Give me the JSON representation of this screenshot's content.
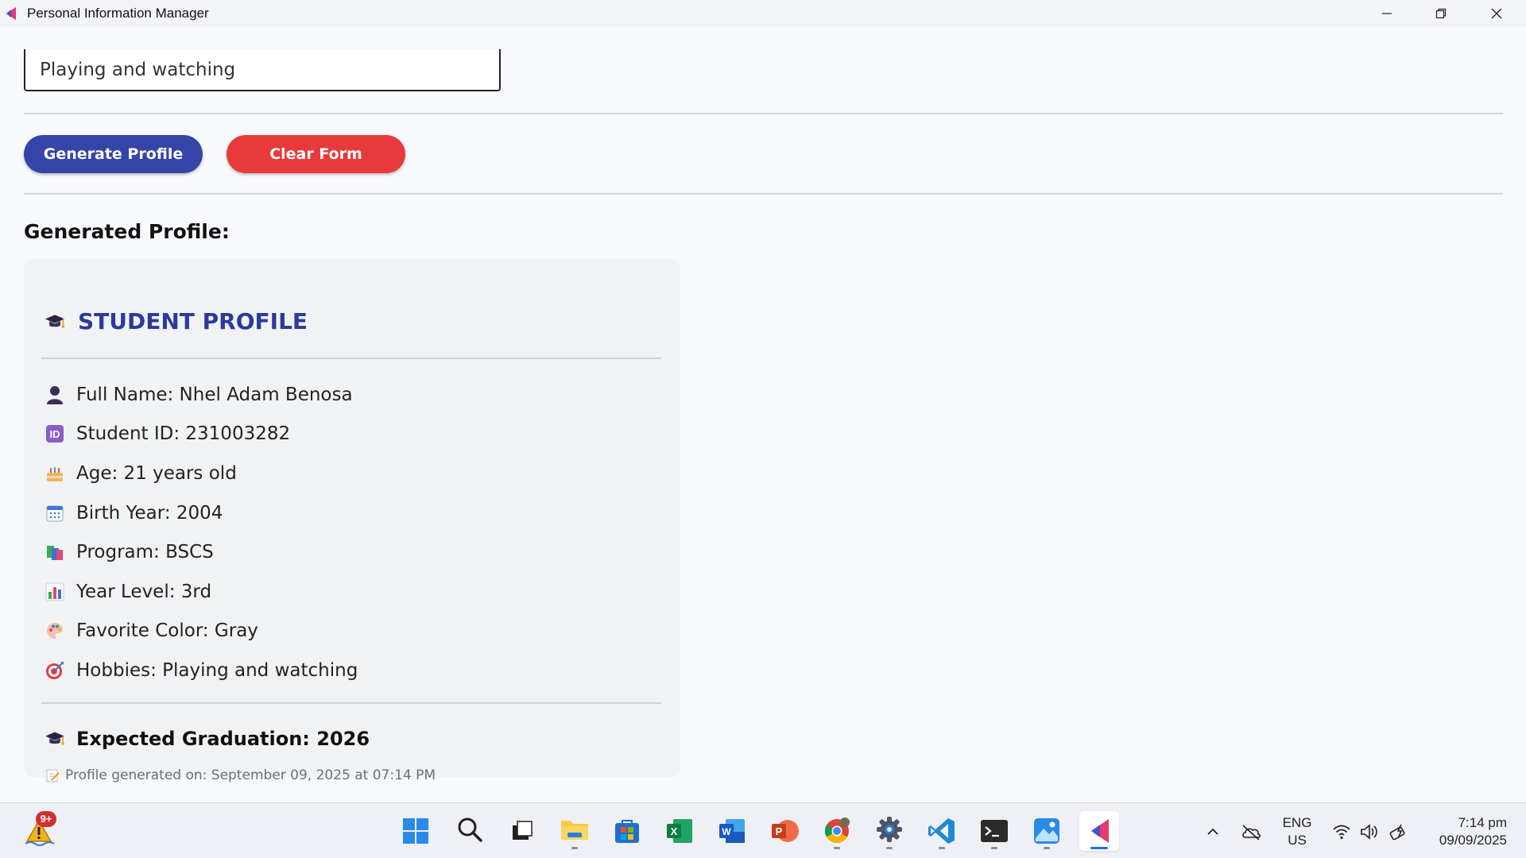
{
  "window": {
    "title": "Personal Information Manager"
  },
  "form": {
    "hobbies_value": "Playing and watching",
    "generate_label": "Generate Profile",
    "clear_label": "Clear Form"
  },
  "output": {
    "section_title": "Generated Profile:",
    "card": {
      "title": "STUDENT PROFILE",
      "title_icon": "graduation-cap-icon",
      "items": [
        {
          "icon": "person-icon",
          "text": "Full Name: Nhel Adam Benosa"
        },
        {
          "icon": "id-icon",
          "text": "Student ID: 231003282"
        },
        {
          "icon": "cake-icon",
          "text": "Age: 21 years old"
        },
        {
          "icon": "calendar-icon",
          "text": "Birth Year: 2004"
        },
        {
          "icon": "books-icon",
          "text": "Program: BSCS"
        },
        {
          "icon": "bar-chart-icon",
          "text": "Year Level: 3rd"
        },
        {
          "icon": "palette-icon",
          "text": "Favorite Color: Gray"
        },
        {
          "icon": "target-icon",
          "text": "Hobbies: Playing and watching"
        }
      ],
      "graduation": "Expected Graduation: 2026",
      "timestamp": "Profile generated on: September 09, 2025 at 07:14 PM"
    }
  },
  "taskbar": {
    "weather_badge": "9+",
    "apps": [
      "windows-start",
      "search",
      "task-view",
      "file-explorer",
      "microsoft-store",
      "excel",
      "word",
      "powerpoint",
      "chrome",
      "settings",
      "vscode",
      "terminal",
      "photos",
      "personal-information-manager"
    ],
    "lang_line1": "ENG",
    "lang_line2": "US",
    "time": "7:14 pm",
    "date": "09/09/2025"
  },
  "colors": {
    "primary": "#3545a7",
    "danger": "#e83a3a",
    "card_title": "#2b3a9c"
  }
}
